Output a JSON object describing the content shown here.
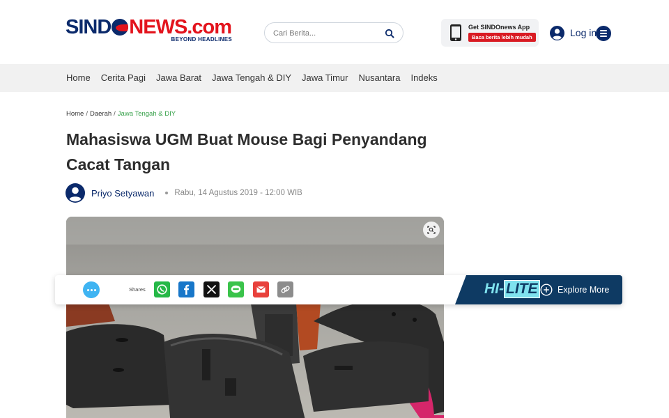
{
  "header": {
    "logo": {
      "brand_left": "SIND",
      "brand_mid": "NEWS",
      "brand_right": ".com",
      "tagline": "BEYOND HEADLINES"
    },
    "search": {
      "placeholder": "Cari Berita...",
      "icon": "search-icon"
    },
    "app_promo": {
      "title": "Get SINDOnews App",
      "badge": "Baca berita lebih mudah",
      "icon": "smartphone-icon"
    },
    "login": {
      "label": "Log in",
      "icon": "user-circle-icon"
    },
    "menu": {
      "icon": "hamburger-menu-icon"
    }
  },
  "nav": {
    "items": [
      "Home",
      "Cerita Pagi",
      "Jawa Barat",
      "Jawa Tengah & DIY",
      "Jawa Timur",
      "Nusantara",
      "Indeks"
    ]
  },
  "breadcrumb": {
    "items": [
      "Home",
      "Daerah",
      "Jawa Tengah & DIY"
    ]
  },
  "article": {
    "title": "Mahasiswa UGM Buat Mouse Bagi Penyandang Cacat Tangan",
    "author": "Priyo Setyawan",
    "date": "Rabu, 14 Agustus 2019 - 12:00 WIB",
    "image_zoom_icon": "zoom-scan-icon"
  },
  "sharebar": {
    "shares_label": "Shares",
    "comment_icon": "comment-bubble-icon",
    "share_buttons": [
      {
        "name": "whatsapp",
        "icon": "whatsapp-icon",
        "color": "#25b847"
      },
      {
        "name": "facebook",
        "icon": "facebook-icon",
        "color": "#1877c9"
      },
      {
        "name": "x",
        "icon": "x-icon",
        "color": "#111111"
      },
      {
        "name": "line",
        "icon": "line-icon",
        "color": "#3ac34a"
      },
      {
        "name": "email",
        "icon": "email-icon",
        "color": "#e8413c"
      },
      {
        "name": "copy-link",
        "icon": "link-icon",
        "color": "#8c8c8c"
      }
    ],
    "hilite": {
      "logo_left": "HI-",
      "logo_right": "LITE",
      "explore_label": "Explore More"
    }
  },
  "colors": {
    "brand_navy": "#0b2a6b",
    "brand_red": "#e3141d",
    "breadcrumb_active": "#37a14a",
    "hilite_bg": "#0e3a63"
  }
}
